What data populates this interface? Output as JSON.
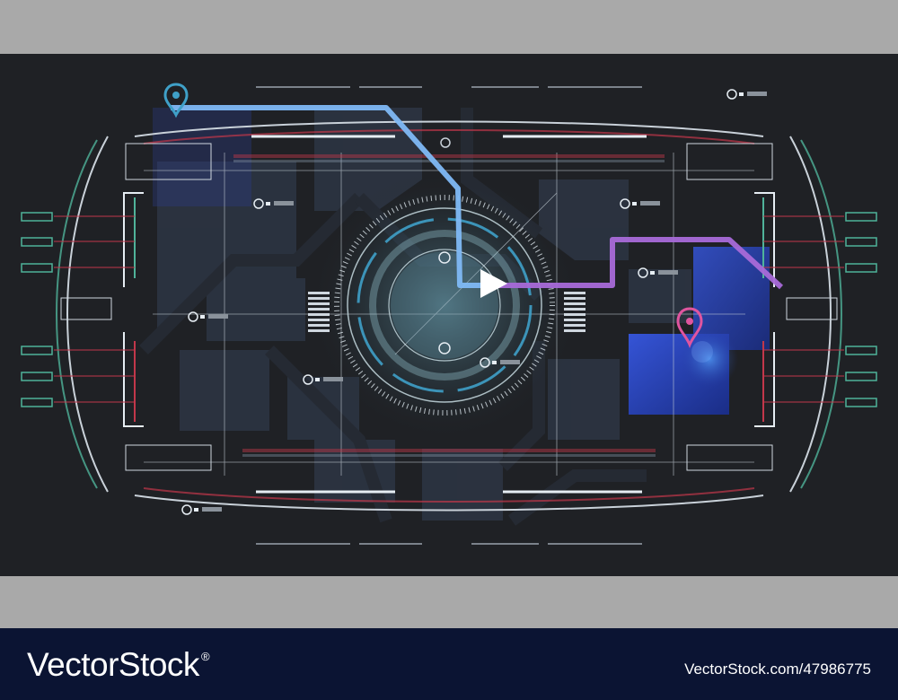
{
  "screen": {
    "center_mark": "play-arrow-icon",
    "route_colors": {
      "primary": "#7fb9f5",
      "secondary": "#a86ad8"
    },
    "accent_colors": {
      "cyan": "#3fa0c8",
      "magenta": "#e0559f",
      "teal": "#4fb39a",
      "red": "#c2374a",
      "panel_blue": "#2741a8"
    },
    "pins": [
      {
        "name": "map-pin-cyan-icon",
        "label": ""
      },
      {
        "name": "map-pin-magenta-icon",
        "label": ""
      },
      {
        "name": "map-pin-white-icon",
        "label": ""
      }
    ]
  },
  "footer": {
    "brand": "VectorStock",
    "reg_mark": "®",
    "image_id": "VectorStock.com/47986775"
  }
}
